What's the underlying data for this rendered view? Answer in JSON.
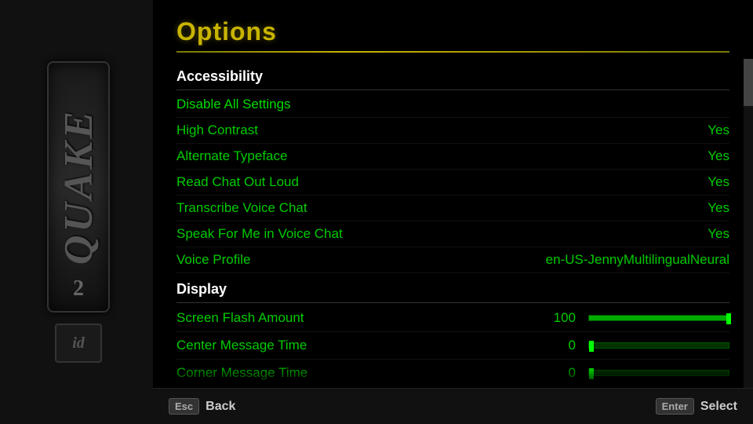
{
  "title": "Options",
  "sections": [
    {
      "name": "Accessibility",
      "items": [
        {
          "label": "Disable All Settings",
          "value": "",
          "type": "plain"
        },
        {
          "label": "High Contrast",
          "value": "Yes",
          "type": "value"
        },
        {
          "label": "Alternate Typeface",
          "value": "Yes",
          "type": "value"
        },
        {
          "label": "Read Chat Out Loud",
          "value": "Yes",
          "type": "value"
        },
        {
          "label": "Transcribe Voice Chat",
          "value": "Yes",
          "type": "value"
        },
        {
          "label": "Speak For Me in Voice Chat",
          "value": "Yes",
          "type": "value"
        },
        {
          "label": "Voice Profile",
          "value": "en-US-JennyMultilingualNeural",
          "type": "value"
        }
      ]
    },
    {
      "name": "Display",
      "items": [
        {
          "label": "Screen Flash Amount",
          "value": "100",
          "type": "slider",
          "pct": 100
        },
        {
          "label": "Center Message Time",
          "value": "0",
          "type": "slider",
          "pct": 3
        },
        {
          "label": "Corner Message Time",
          "value": "0",
          "type": "slider",
          "pct": 3
        }
      ]
    }
  ],
  "bottom": {
    "back_key": "Esc",
    "back_label": "Back",
    "select_key": "Enter",
    "select_label": "Select"
  }
}
